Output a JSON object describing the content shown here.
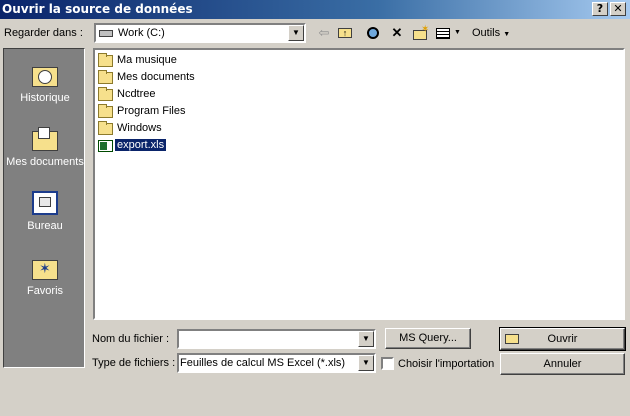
{
  "window": {
    "title": "Ouvrir la source de données",
    "help_button": "?",
    "close_button": "✕"
  },
  "toolbar": {
    "look_in_label": "Regarder dans :",
    "look_in_value": "Work (C:)",
    "tools_label": "Outils"
  },
  "places": [
    {
      "label": "Historique",
      "icon": "history-icon"
    },
    {
      "label": "Mes documents",
      "icon": "my-documents-icon"
    },
    {
      "label": "Bureau",
      "icon": "desktop-icon"
    },
    {
      "label": "Favoris",
      "icon": "favorites-icon"
    }
  ],
  "files": [
    {
      "name": "Ma musique",
      "type": "folder"
    },
    {
      "name": "Mes documents",
      "type": "folder"
    },
    {
      "name": "Ncdtree",
      "type": "folder"
    },
    {
      "name": "Program Files",
      "type": "folder"
    },
    {
      "name": "Windows",
      "type": "folder"
    },
    {
      "name": "export.xls",
      "type": "xls",
      "selected": true
    }
  ],
  "form": {
    "filename_label": "Nom du fichier :",
    "filename_value": "",
    "filetype_label": "Type de fichiers :",
    "filetype_value": "Feuilles de calcul MS Excel (*.xls)",
    "ms_query_button": "MS Query...",
    "choose_import_label": "Choisir l'importation",
    "open_button": "Ouvrir",
    "cancel_button": "Annuler"
  }
}
